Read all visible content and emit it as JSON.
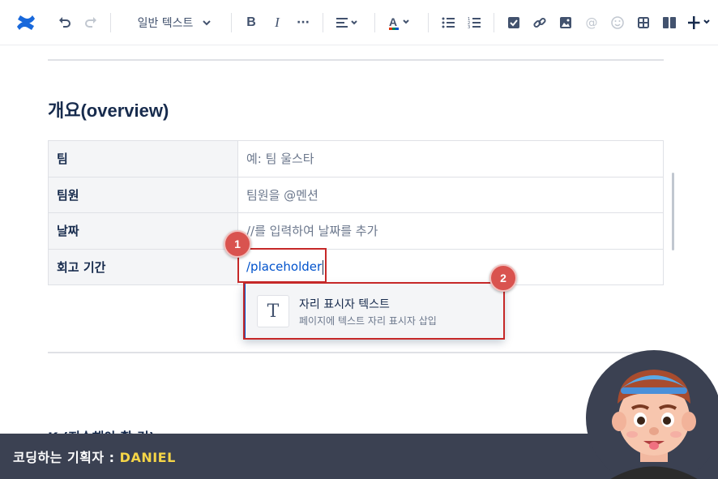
{
  "toolbar": {
    "text_style": "일반 텍스트",
    "icons": [
      "confluence-logo",
      "undo",
      "redo",
      "text-style-dropdown",
      "bold",
      "italic",
      "more",
      "align",
      "text-color",
      "bullet-list",
      "numbered-list",
      "task",
      "link",
      "image",
      "mention",
      "emoji",
      "table",
      "layout",
      "insert"
    ]
  },
  "doc": {
    "heading": "개요(overview)",
    "rows": [
      {
        "label": "팀",
        "value": "예: 팀 울스타",
        "placeholder": true
      },
      {
        "label": "팀원",
        "value": "팀원을 @멘션",
        "placeholder": true
      },
      {
        "label": "날짜",
        "value": "//를 입력하여 날짜를 추가",
        "placeholder": true
      },
      {
        "label": "회고 기간",
        "value": "/placeholder",
        "placeholder": false
      }
    ],
    "next_heading_partial": "K    (지속해야 할 것)"
  },
  "menu": {
    "icon_letter": "T",
    "title": "자리 표시자 텍스트",
    "description": "페이지에 텍스트 자리 표시자 삽입"
  },
  "callouts": [
    "1",
    "2"
  ],
  "banner": {
    "prefix": "코딩하는 기획자 : ",
    "name": "DANIEL"
  },
  "colors": {
    "accent": "#0052cc",
    "callout": "#c62828",
    "banner_bg": "#3b4152",
    "banner_name": "#f5d547"
  }
}
